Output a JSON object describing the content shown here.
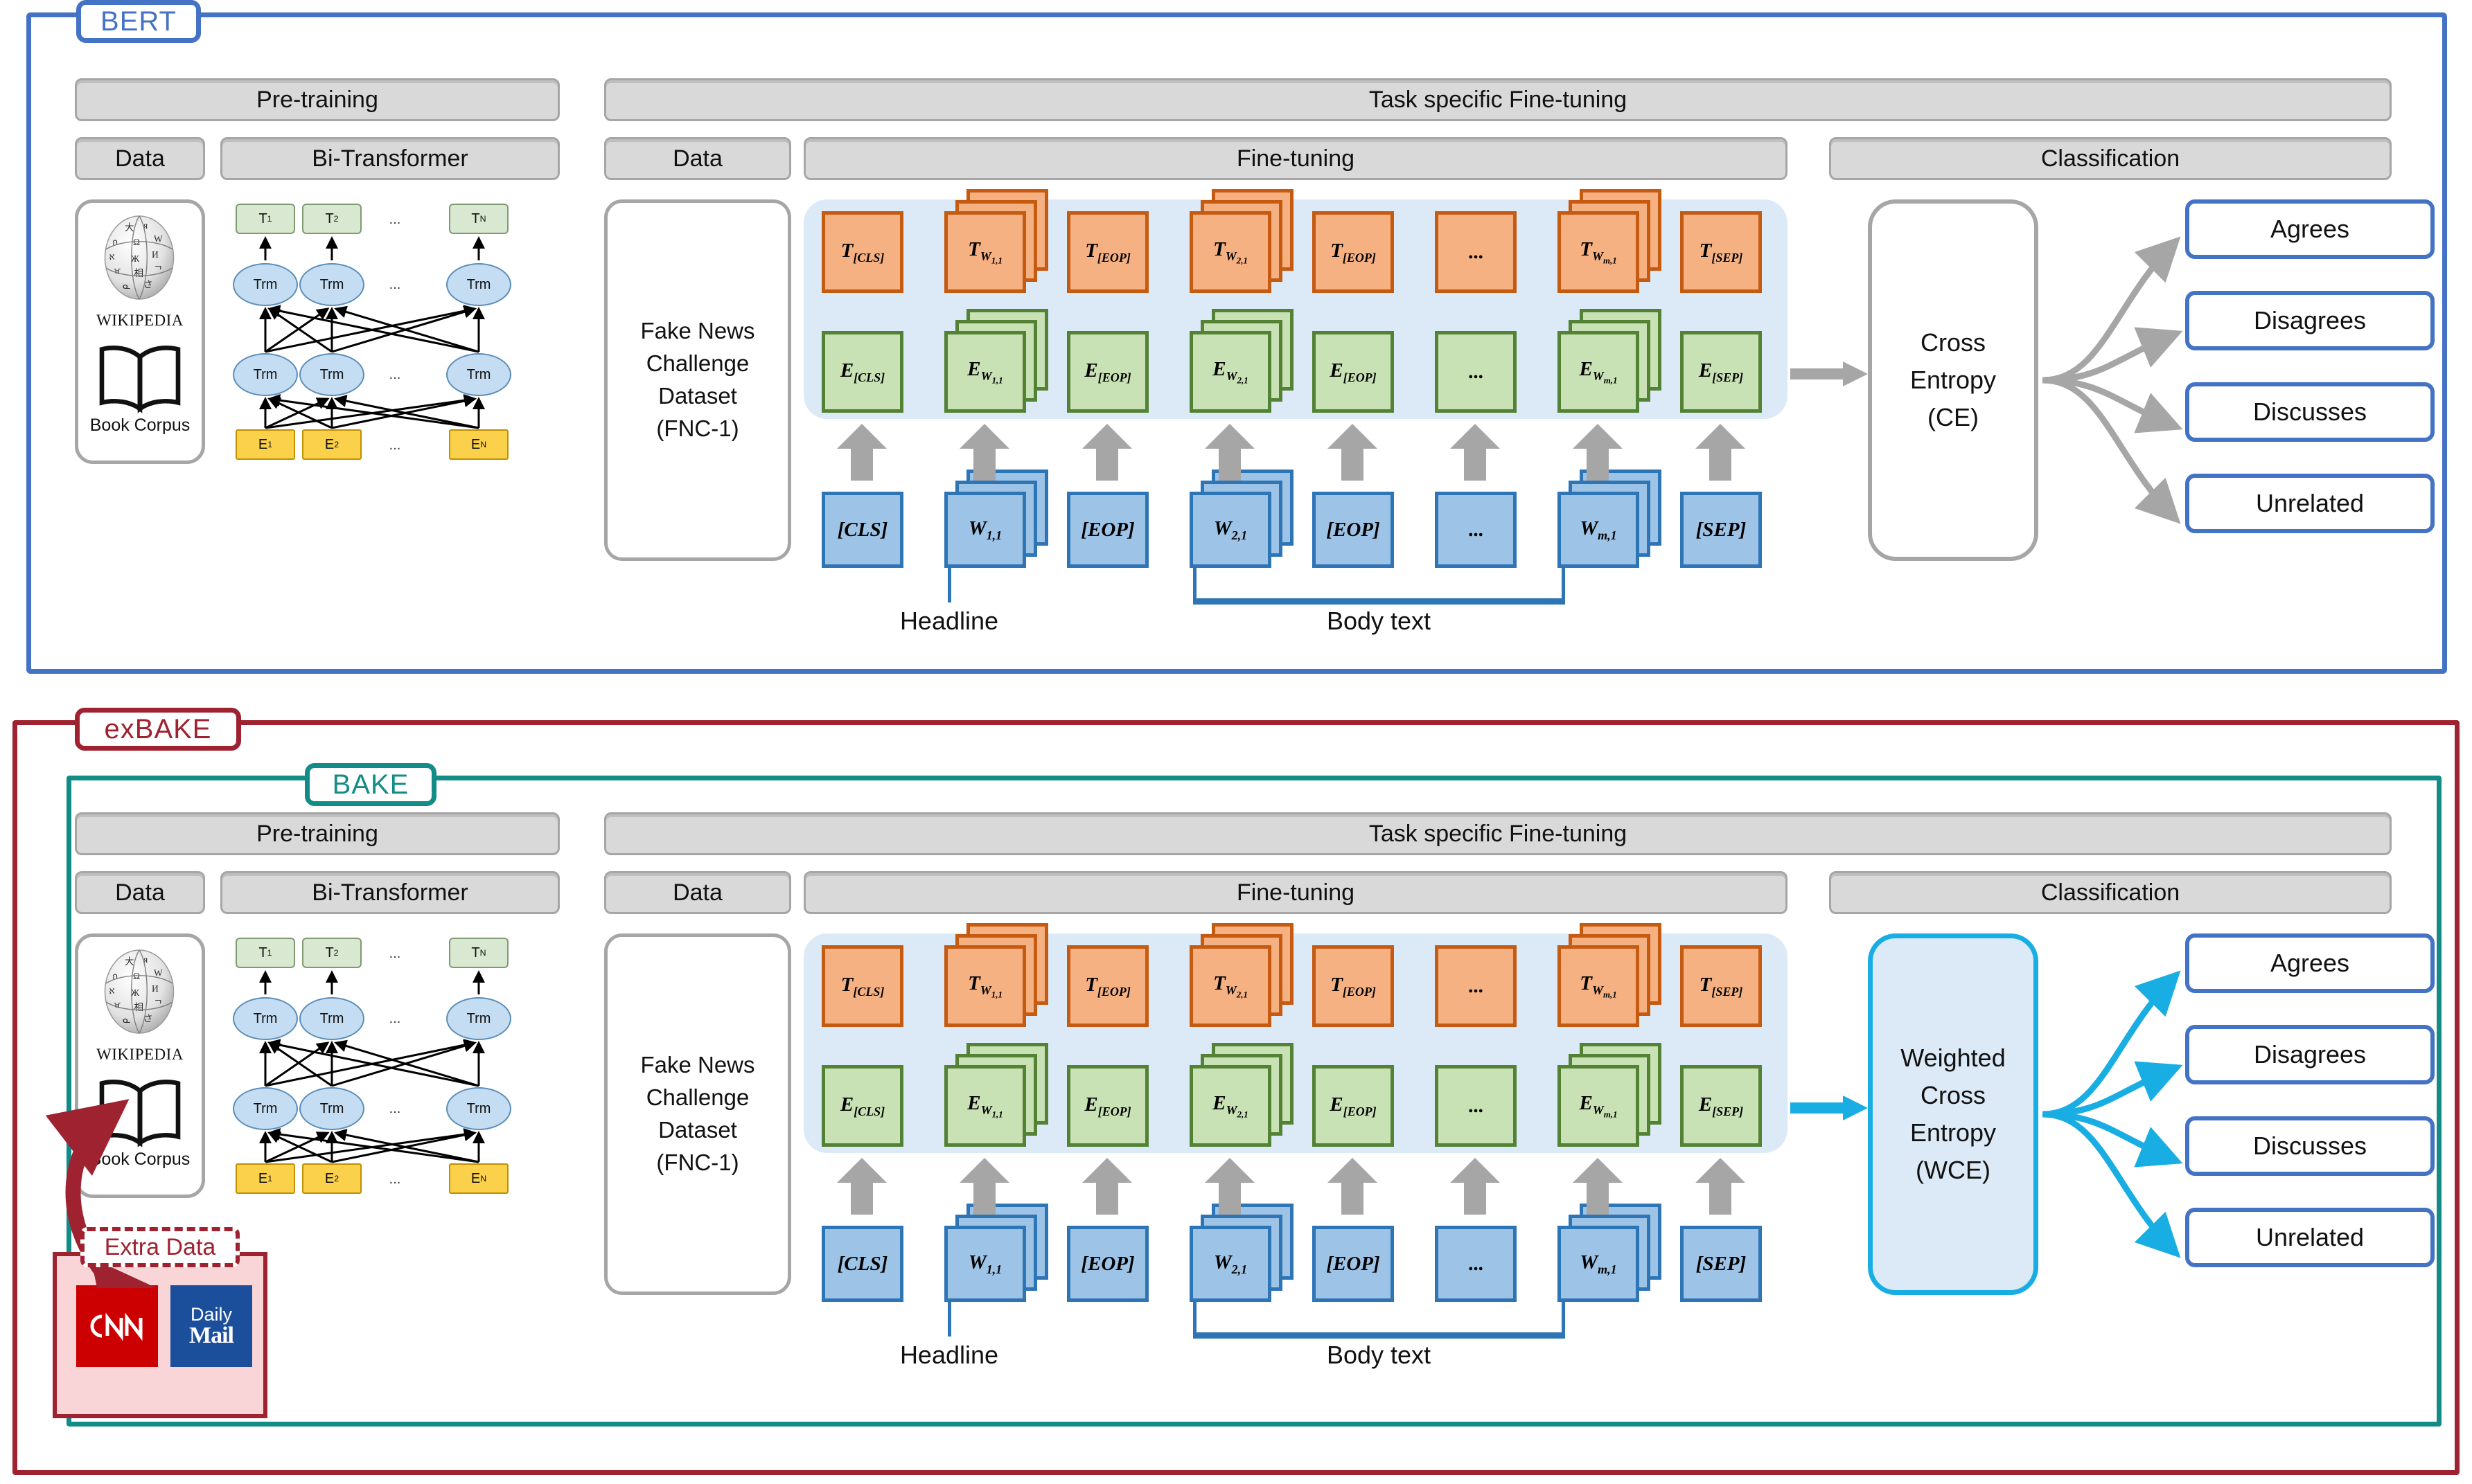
{
  "figure": {
    "frames": [
      {
        "id": "bert",
        "label": "BERT",
        "color": "#4472C4"
      },
      {
        "id": "exbake",
        "label": "exBAKE",
        "color": "#9E2230"
      },
      {
        "id": "bake",
        "label": "BAKE",
        "color": "#138B86"
      }
    ]
  },
  "headers": {
    "pretraining": "Pre-training",
    "data": "Data",
    "bi_transformer": "Bi-Transformer",
    "task_specific": "Task specific Fine-tuning",
    "fine_tuning": "Fine-tuning",
    "classification": "Classification"
  },
  "pretrain": {
    "sources": [
      {
        "name": "wikipedia",
        "label": "WIKIPEDIA"
      },
      {
        "name": "book-corpus",
        "label": "Book Corpus"
      }
    ],
    "transformer": {
      "outputs": [
        "T",
        "T",
        "T"
      ],
      "output_subs": [
        "1",
        "2",
        "N"
      ],
      "inputs": [
        "E",
        "E",
        "E"
      ],
      "input_subs": [
        "1",
        "2",
        "N"
      ],
      "cell_label": "Trm",
      "ellipsis": "..."
    }
  },
  "dataset": {
    "lines": [
      "Fake News",
      "Challenge",
      "Dataset",
      "(FNC-1)"
    ]
  },
  "tokens": {
    "ellipsis": "...",
    "columns": [
      {
        "key": "cls",
        "T": "T",
        "T_sub": "[CLS]",
        "E": "E",
        "E_sub": "[CLS]",
        "W": "[CLS]",
        "W_sub": "",
        "stacked": false
      },
      {
        "key": "w11",
        "T": "T",
        "T_sub": "W",
        "E": "E",
        "E_sub": "W",
        "W": "W",
        "W_sub": "1,1",
        "stacked": true,
        "sub2": "1,1"
      },
      {
        "key": "eop1",
        "T": "T",
        "T_sub": "[EOP]",
        "E": "E",
        "E_sub": "[EOP]",
        "W": "[EOP]",
        "W_sub": "",
        "stacked": false
      },
      {
        "key": "w21",
        "T": "T",
        "T_sub": "W",
        "E": "E",
        "E_sub": "W",
        "W": "W",
        "W_sub": "2,1",
        "stacked": true,
        "sub2": "2,1"
      },
      {
        "key": "eop2",
        "T": "T",
        "T_sub": "[EOP]",
        "E": "E",
        "E_sub": "[EOP]",
        "W": "[EOP]",
        "W_sub": "",
        "stacked": false
      },
      {
        "key": "dots",
        "T": "...",
        "T_sub": "",
        "E": "...",
        "E_sub": "",
        "W": "...",
        "W_sub": "",
        "stacked": false
      },
      {
        "key": "wm1",
        "T": "T",
        "T_sub": "W",
        "E": "E",
        "E_sub": "W",
        "W": "W",
        "W_sub": "m,1",
        "stacked": true,
        "sub2": "m,1"
      },
      {
        "key": "sep",
        "T": "T",
        "T_sub": "[SEP]",
        "E": "E",
        "E_sub": "[SEP]",
        "W": "[SEP]",
        "W_sub": "",
        "stacked": false
      }
    ]
  },
  "captions": {
    "headline": "Headline",
    "body_text": "Body text"
  },
  "loss": {
    "bert": {
      "lines": [
        "Cross",
        "Entropy",
        "(CE)"
      ],
      "accent": "#A6A6A6"
    },
    "bake": {
      "lines": [
        "Weighted",
        "Cross",
        "Entropy",
        "(WCE)"
      ],
      "accent": "#19AEE3"
    }
  },
  "classes": [
    "Agrees",
    "Disagrees",
    "Discusses",
    "Unrelated"
  ],
  "extra_data": {
    "title": "Extra Data",
    "logos": [
      {
        "name": "cnn-logo",
        "label": "CNN",
        "color": "#CC0000"
      },
      {
        "name": "daily-mail-logo",
        "label_top": "Daily",
        "label_bottom": "Mail",
        "color": "#1B4F9C"
      }
    ]
  },
  "colors": {
    "bert_frame": "#4472C4",
    "exbake_frame": "#9E2230",
    "bake_frame": "#138B86",
    "token_T_fill": "#F6B183",
    "token_T_border": "#C55A11",
    "token_E_fill": "#C9E2B5",
    "token_E_border": "#548235",
    "token_W_fill": "#9DC3E6",
    "token_W_border": "#2E75B6",
    "ft_zone": "#DCE9F7",
    "header_pill": "#D9D9D9",
    "wce_accent": "#19AEE3",
    "arrow_gray": "#A6A6A6"
  }
}
